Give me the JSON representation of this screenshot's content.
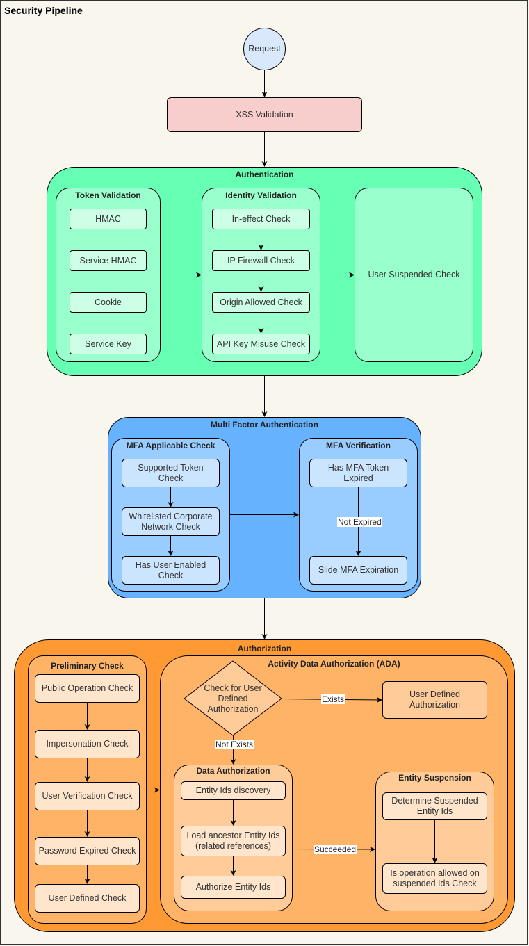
{
  "diagram": {
    "title": "Security Pipeline",
    "request": "Request",
    "xss": "XSS Validation",
    "authentication": {
      "title": "Authentication",
      "token_validation": {
        "title": "Token Validation",
        "items": [
          "HMAC",
          "Service HMAC",
          "Cookie",
          "Service Key"
        ]
      },
      "identity_validation": {
        "title": "Identity Validation",
        "items": [
          "In-effect Check",
          "IP Firewall Check",
          "Origin Allowed Check",
          "API Key Misuse Check"
        ]
      },
      "user_suspended": "User Suspended Check"
    },
    "mfa": {
      "title": "Multi Factor Authentication",
      "applicable": {
        "title": "MFA Applicable Check",
        "items": [
          "Supported Token Check",
          "Whitelisted Corporate Network Check",
          "Has User Enabled Check"
        ]
      },
      "verification": {
        "title": "MFA Verification",
        "items": [
          "Has MFA Token Expired",
          "Slide MFA Expiration"
        ],
        "edge_label": "Not Expired"
      }
    },
    "authorization": {
      "title": "Authorization",
      "preliminary": {
        "title": "Preliminary Check",
        "items": [
          "Public Operation Check",
          "Impersonation Check",
          "User Verification Check",
          "Password Expired Check",
          "User Defined Check"
        ]
      },
      "ada": {
        "title": "Activity Data Authorization (ADA)",
        "decision": "Check for User Defined Authorization",
        "exists_label": "Exists",
        "not_exists_label": "Not Exists",
        "user_defined": "User Defined Authorization",
        "data_authorization": {
          "title": "Data Authorization",
          "items": [
            "Entity Ids discovery",
            "Load ancestor Entity Ids (related references)",
            "Authorize Entity Ids"
          ]
        },
        "succeeded_label": "Succeeded",
        "entity_suspension": {
          "title": "Entity Suspension",
          "items": [
            "Determine Suspended Entity Ids",
            "Is operation allowed on suspended Ids Check"
          ]
        }
      }
    }
  }
}
